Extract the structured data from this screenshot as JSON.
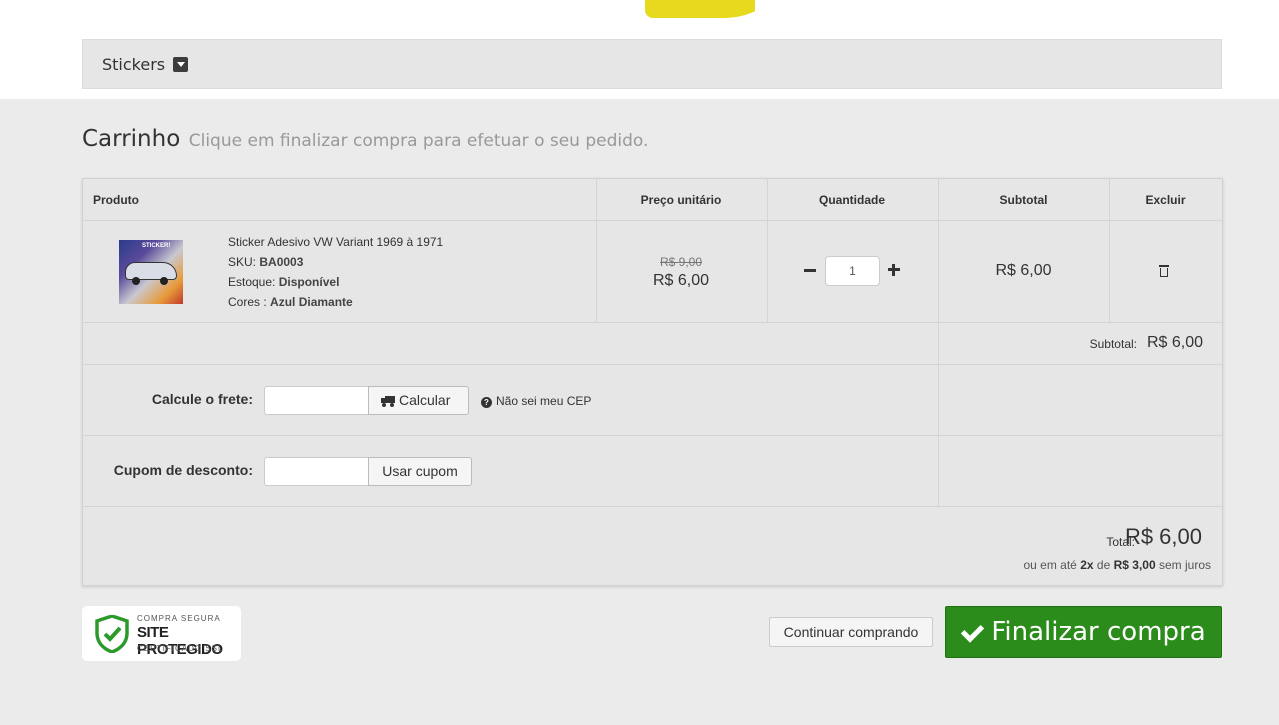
{
  "category": {
    "label": "Stickers"
  },
  "cart": {
    "title": "Carrinho",
    "subtitle": "Clique em finalizar compra para efetuar o seu pedido.",
    "headers": {
      "product": "Produto",
      "unit_price": "Preço unitário",
      "quantity": "Quantidade",
      "subtotal": "Subtotal",
      "remove": "Excluir"
    },
    "item": {
      "name": "Sticker Adesivo VW Variant 1969 à 1971",
      "sku_label": "SKU:",
      "sku": "BA0003",
      "stock_label": "Estoque:",
      "stock": "Disponível",
      "color_label": "Cores :",
      "color": "Azul Diamante",
      "image_text": "STICKER!",
      "old_price": "R$ 9,00",
      "price": "R$ 6,00",
      "quantity": "1",
      "subtotal": "R$ 6,00"
    },
    "subtotal_label": "Subtotal:",
    "subtotal_value": "R$ 6,00",
    "shipping": {
      "label": "Calcule o frete:",
      "button": "Calcular",
      "help": "Não sei meu CEP"
    },
    "coupon": {
      "label": "Cupom de desconto:",
      "button": "Usar cupom"
    },
    "total_label": "Total:",
    "total_value": "R$ 6,00",
    "installment": {
      "prefix": "ou em até",
      "times": "2x",
      "of": "de",
      "amount": "R$ 3,00",
      "suffix": "sem juros"
    }
  },
  "seal": {
    "line1": "COMPRA SEGURA",
    "line2": "SITE PROTEGIDO",
    "line3": "CERTIFICADO SSL"
  },
  "actions": {
    "continue": "Continuar comprando",
    "checkout": "Finalizar compra"
  },
  "colors": {
    "checkout_bg": "#2b8c1b",
    "logo_yellow": "#e6d91e",
    "seal_green": "#2b9a2b"
  }
}
